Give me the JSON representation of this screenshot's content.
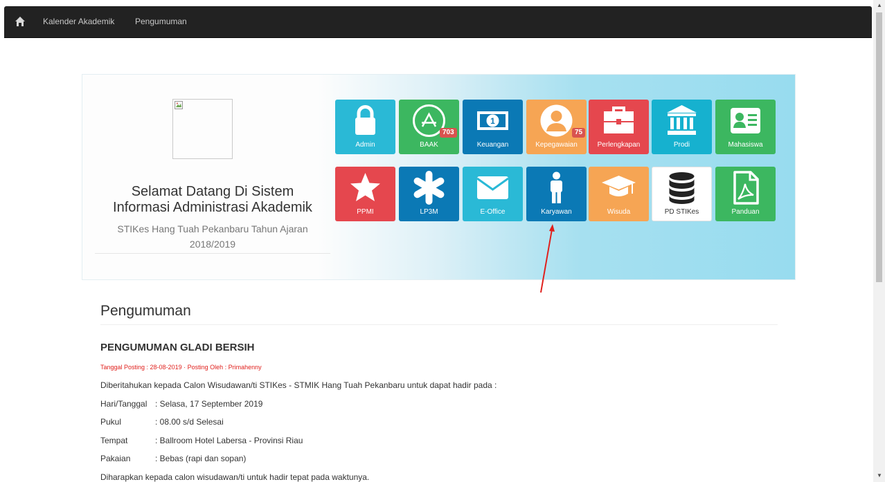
{
  "navbar": {
    "home_icon": "home-icon",
    "links": [
      "Kalender Akademik",
      "Pengumuman"
    ]
  },
  "hero": {
    "title_line1": "Selamat Datang Di Sistem",
    "title_line2": "Informasi Administrasi Akademik",
    "subtitle_line1": "STIKes Hang Tuah Pekanbaru Tahun Ajaran",
    "subtitle_line2": "2018/2019"
  },
  "tiles": [
    {
      "label": "Admin",
      "icon": "lock-icon",
      "color": "#2ab9d6"
    },
    {
      "label": "BAAK",
      "icon": "triangle-circle-icon",
      "color": "#3cb760",
      "badge": "703"
    },
    {
      "label": "Keuangan",
      "icon": "money-icon",
      "color": "#0b79b5"
    },
    {
      "label": "Kepegawaian",
      "icon": "user-circle-icon",
      "color": "#f6a554",
      "badge": "75"
    },
    {
      "label": "Perlengkapan",
      "icon": "briefcase-icon",
      "color": "#e5474e"
    },
    {
      "label": "Prodi",
      "icon": "institution-icon",
      "color": "#16b1cf"
    },
    {
      "label": "Mahasiswa",
      "icon": "id-card-icon",
      "color": "#3cb760"
    },
    {
      "label": "PPMI",
      "icon": "star-icon",
      "color": "#e5474e"
    },
    {
      "label": "LP3M",
      "icon": "asterisk-icon",
      "color": "#0b79b5"
    },
    {
      "label": "E-Office",
      "icon": "envelope-icon",
      "color": "#2ab9d6"
    },
    {
      "label": "Karyawan",
      "icon": "male-icon",
      "color": "#0b79b5"
    },
    {
      "label": "Wisuda",
      "icon": "graduation-cap-icon",
      "color": "#f6a554"
    },
    {
      "label": "PD STIKes",
      "icon": "database-icon",
      "color": "#ffffff"
    },
    {
      "label": "Panduan",
      "icon": "pdf-file-icon",
      "color": "#3cb760"
    }
  ],
  "content": {
    "section_title": "Pengumuman",
    "post_title": "PENGUMUMAN GLADI BERSIH",
    "post_meta": "Tanggal Posting : 28-08-2019 · Posting Oleh : Primahenny",
    "intro": "Diberitahukan kepada Calon Wisudawan/ti STIKes - STMIK Hang Tuah Pekanbaru untuk dapat hadir pada :",
    "details": [
      {
        "key": "Hari/Tanggal",
        "value": ": Selasa, 17 September 2019"
      },
      {
        "key": "Pukul",
        "value": ": 08.00 s/d Selesai"
      },
      {
        "key": "Tempat",
        "value": ": Ballroom Hotel Labersa - Provinsi Riau"
      },
      {
        "key": "Pakaian",
        "value": ": Bebas (rapi dan sopan)"
      }
    ],
    "closing": "Diharapkan kepada calon wisudawan/ti untuk hadir tepat pada waktunya."
  }
}
